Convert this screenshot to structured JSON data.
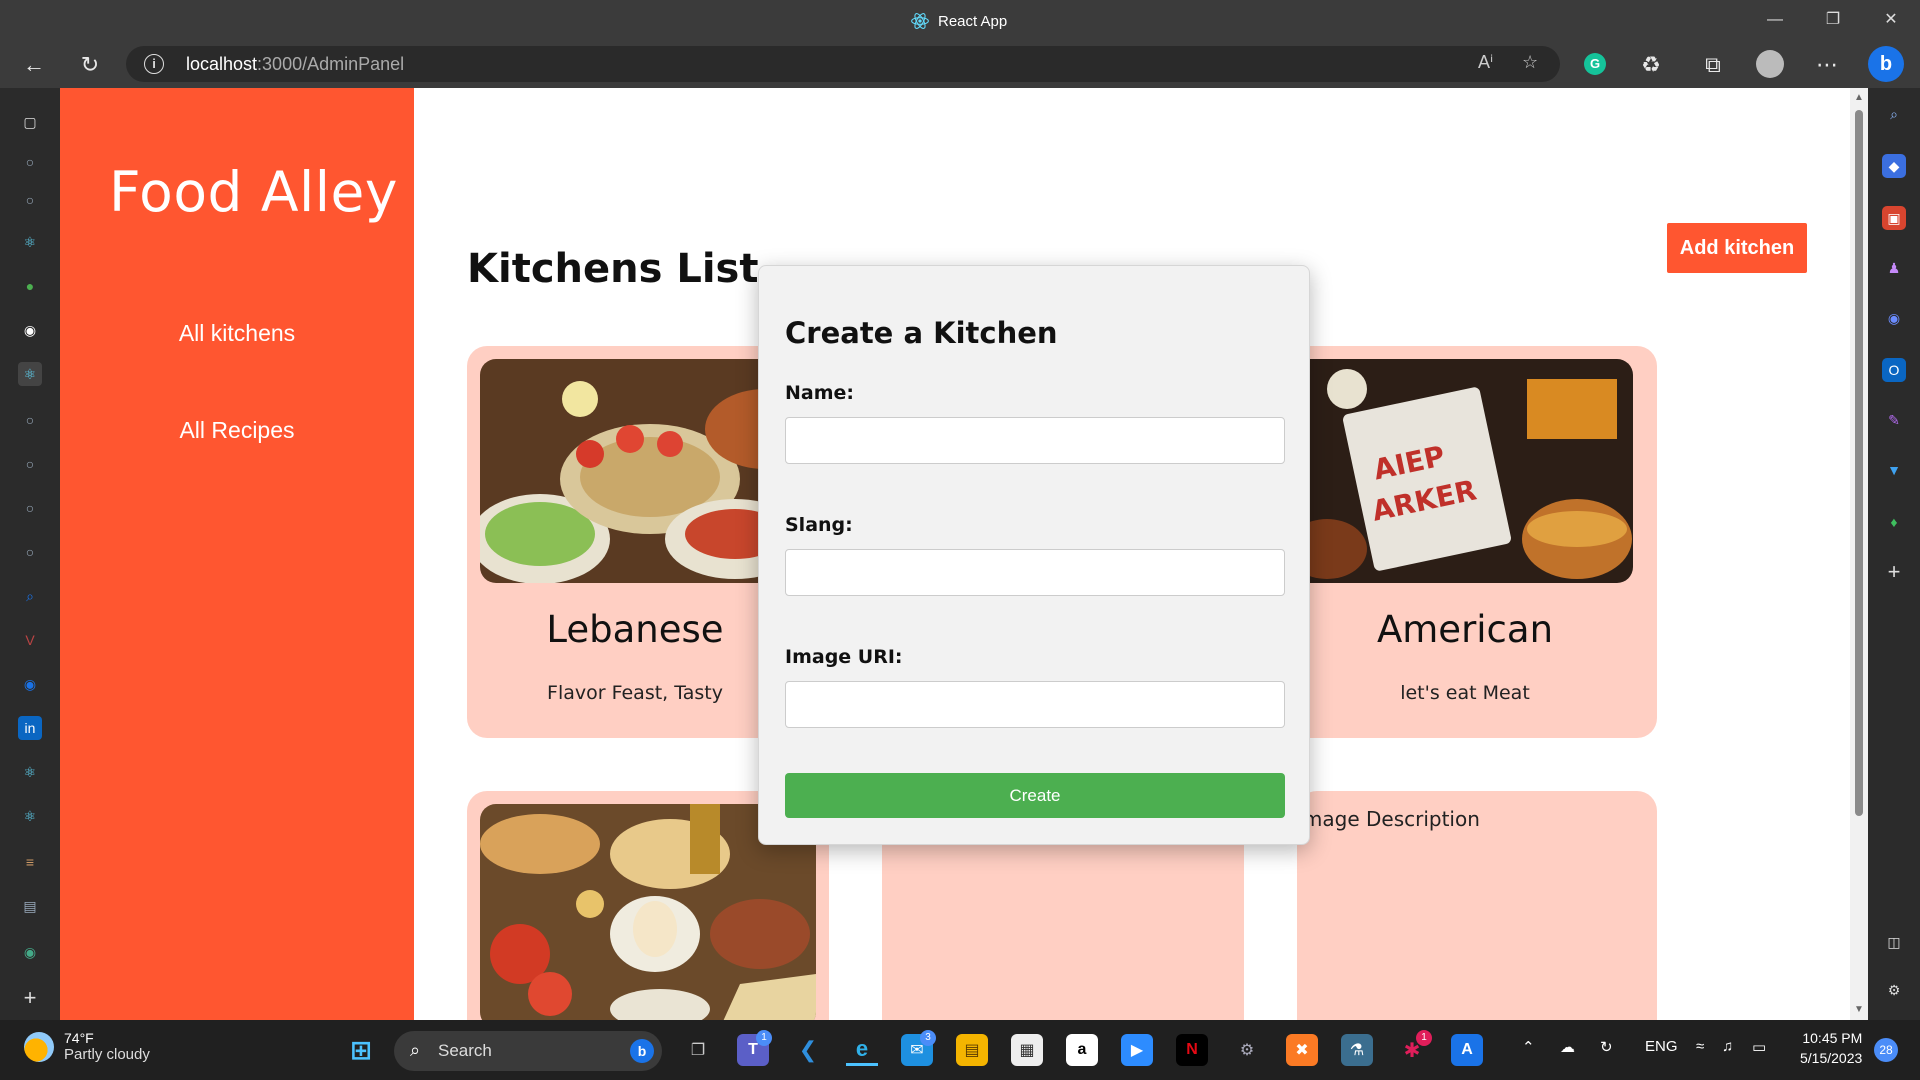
{
  "window": {
    "title": "React App"
  },
  "browser": {
    "url_host": "localhost",
    "url_path": ":3000/AdminPanel"
  },
  "sidebar": {
    "brand": "Food Alley",
    "links": [
      "All kitchens",
      "All Recipes"
    ]
  },
  "main": {
    "title": "Kitchens List",
    "add_button": "Add kitchen",
    "cards": [
      {
        "name": "Lebanese",
        "slang": "Flavor Feast, Tasty"
      },
      {
        "name": "American",
        "slang": "let's eat Meat"
      }
    ],
    "broken_image_alt": "Image Description"
  },
  "modal": {
    "title": "Create a Kitchen",
    "name_label": "Name:",
    "slang_label": "Slang:",
    "image_label": "Image URI:",
    "name_value": "",
    "slang_value": "",
    "image_value": "",
    "create_button": "Create"
  },
  "taskbar": {
    "temperature": "74°F",
    "weather": "Partly cloudy",
    "search": "Search",
    "language": "ENG",
    "time": "10:45 PM",
    "date": "5/15/2023",
    "notifications": "28",
    "badges": {
      "teams": "1",
      "mail": "3",
      "slack": "1"
    }
  },
  "colors": {
    "sidebar": "#ff5630",
    "card": "#ffcfc3",
    "create_button": "#4caf50"
  }
}
